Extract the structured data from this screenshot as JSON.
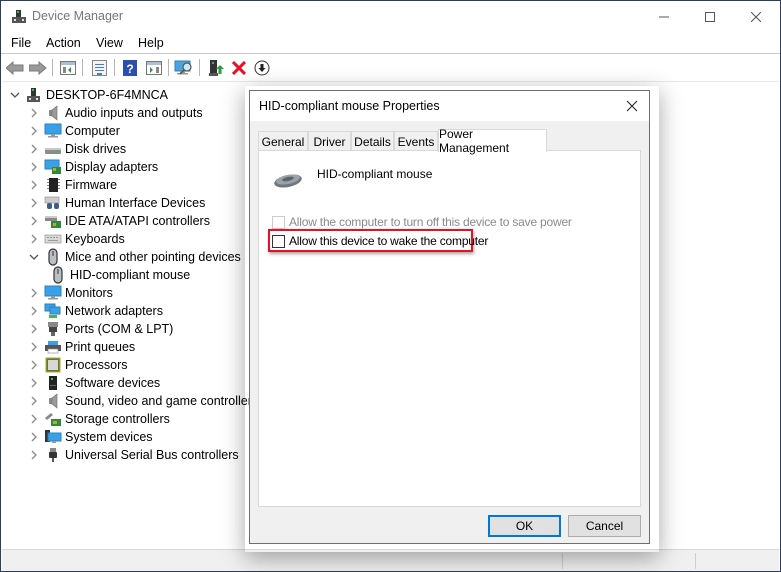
{
  "window": {
    "title": "Device Manager",
    "controls": {
      "minimize": "minimize",
      "maximize": "maximize",
      "close": "close"
    }
  },
  "menu": [
    "File",
    "Action",
    "View",
    "Help"
  ],
  "toolbar": [
    {
      "icon": "back-arrow-icon"
    },
    {
      "icon": "forward-arrow-icon"
    },
    {
      "icon": "show-hide-console-tree-icon"
    },
    {
      "icon": "properties-icon"
    },
    {
      "icon": "help-icon"
    },
    {
      "icon": "show-action-pane-icon"
    },
    {
      "icon": "scan-hardware-changes-icon"
    },
    {
      "icon": "update-driver-icon"
    },
    {
      "icon": "uninstall-device-icon"
    },
    {
      "icon": "disable-device-icon"
    }
  ],
  "tree": {
    "root": "DESKTOP-6F4MNCA",
    "categories": [
      {
        "label": "Audio inputs and outputs",
        "icon": "speaker-icon",
        "expanded": false
      },
      {
        "label": "Computer",
        "icon": "monitor-icon",
        "expanded": false
      },
      {
        "label": "Disk drives",
        "icon": "disk-drive-icon",
        "expanded": false
      },
      {
        "label": "Display adapters",
        "icon": "display-adapter-icon",
        "expanded": false
      },
      {
        "label": "Firmware",
        "icon": "chip-icon",
        "expanded": false
      },
      {
        "label": "Human Interface Devices",
        "icon": "hid-icon",
        "expanded": false
      },
      {
        "label": "IDE ATA/ATAPI controllers",
        "icon": "ide-controller-icon",
        "expanded": false
      },
      {
        "label": "Keyboards",
        "icon": "keyboard-icon",
        "expanded": false
      },
      {
        "label": "Mice and other pointing devices",
        "icon": "mouse-icon",
        "expanded": true,
        "children": [
          "HID-compliant mouse"
        ]
      },
      {
        "label": "Monitors",
        "icon": "monitor-icon",
        "expanded": false
      },
      {
        "label": "Network adapters",
        "icon": "network-icon",
        "expanded": false
      },
      {
        "label": "Ports (COM & LPT)",
        "icon": "port-icon",
        "expanded": false
      },
      {
        "label": "Print queues",
        "icon": "printer-icon",
        "expanded": false
      },
      {
        "label": "Processors",
        "icon": "processor-icon",
        "expanded": false
      },
      {
        "label": "Software devices",
        "icon": "software-device-icon",
        "expanded": false
      },
      {
        "label": "Sound, video and game controllers",
        "icon": "speaker-icon",
        "expanded": false
      },
      {
        "label": "Storage controllers",
        "icon": "storage-controller-icon",
        "expanded": false
      },
      {
        "label": "System devices",
        "icon": "system-devices-icon",
        "expanded": false
      },
      {
        "label": "Universal Serial Bus controllers",
        "icon": "usb-icon",
        "expanded": false
      }
    ]
  },
  "dialog": {
    "title": "HID-compliant mouse Properties",
    "tabs": [
      "General",
      "Driver",
      "Details",
      "Events",
      "Power Management"
    ],
    "active_tab": "Power Management",
    "device_name": "HID-compliant mouse",
    "options": [
      {
        "label": "Allow the computer to turn off this device to save power",
        "checked": false,
        "enabled": false
      },
      {
        "label": "Allow this device to wake the computer",
        "checked": false,
        "enabled": true,
        "highlighted": true
      }
    ],
    "buttons": {
      "ok": "OK",
      "cancel": "Cancel"
    },
    "highlight_color": "#e81123",
    "default_button_color": "#0078d7"
  }
}
